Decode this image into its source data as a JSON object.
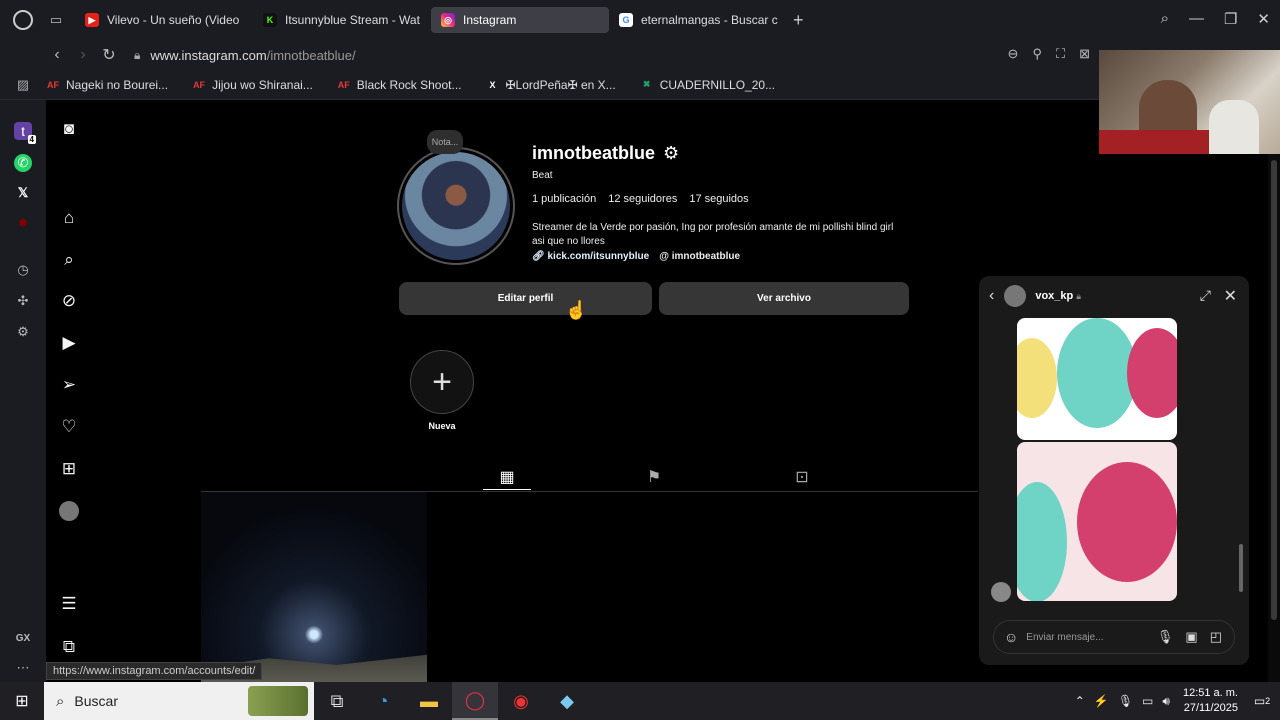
{
  "browser": {
    "tabs": [
      {
        "title": "Vilevo - Un sueño (Video",
        "favicon_color": "#e62117",
        "favicon_glyph": "▶"
      },
      {
        "title": "Itsunnyblue Stream - Wat",
        "favicon_color": "#53fc18",
        "favicon_glyph": "K"
      },
      {
        "title": "Instagram",
        "favicon_color": "#d6249f",
        "favicon_glyph": "◎"
      },
      {
        "title": "eternalmangas - Buscar c",
        "favicon_color": "#4285f4",
        "favicon_glyph": "G"
      }
    ],
    "url_host": "www.instagram.com",
    "url_path": "/imnotbeatblue/",
    "bookmarks": [
      {
        "label": "Nageki no Bourei...",
        "favicon": "AF",
        "color": "#e53935"
      },
      {
        "label": "Jijou wo Shiranai...",
        "favicon": "AF",
        "color": "#e53935"
      },
      {
        "label": "Black Rock Shoot...",
        "favicon": "AF",
        "color": "#e53935"
      },
      {
        "label": "✠LordPeña✠ en X...",
        "favicon": "X",
        "color": "#ffffff"
      },
      {
        "label": "CUADERNILLO_20...",
        "favicon": "✖",
        "color": "#1fa463"
      }
    ],
    "status_link": "https://www.instagram.com/accounts/edit/"
  },
  "opera_sidebar": {
    "icons": [
      "twitch-icon",
      "whatsapp-icon",
      "x-icon",
      "ublock-icon",
      "history-icon",
      "extensions-icon",
      "settings-icon",
      "gx-icon",
      "more-icon"
    ],
    "gx_label": "GX",
    "twitch_badge": "4"
  },
  "profile": {
    "username": "imnotbeatblue",
    "full_name": "Beat",
    "note_label": "Nota...",
    "stats": [
      "1 publicación",
      "12 seguidores",
      "17 seguidos"
    ],
    "bio": "Streamer de la Verde por pasión, Ing por profesión amante de mi pollishi blind girl asi que no llores",
    "link": "kick.com/itsunnyblue",
    "threads": "imnotbeatblue",
    "edit_label": "Editar perfil",
    "archive_label": "Ver archivo",
    "new_highlight_label": "Nueva"
  },
  "dm": {
    "name": "vox_kp",
    "input_placeholder": "Enviar mensaje..."
  },
  "taskbar": {
    "search_label": "Buscar",
    "time": "12:51 a. m.",
    "date": "27/11/2025",
    "notif_count": "2"
  }
}
